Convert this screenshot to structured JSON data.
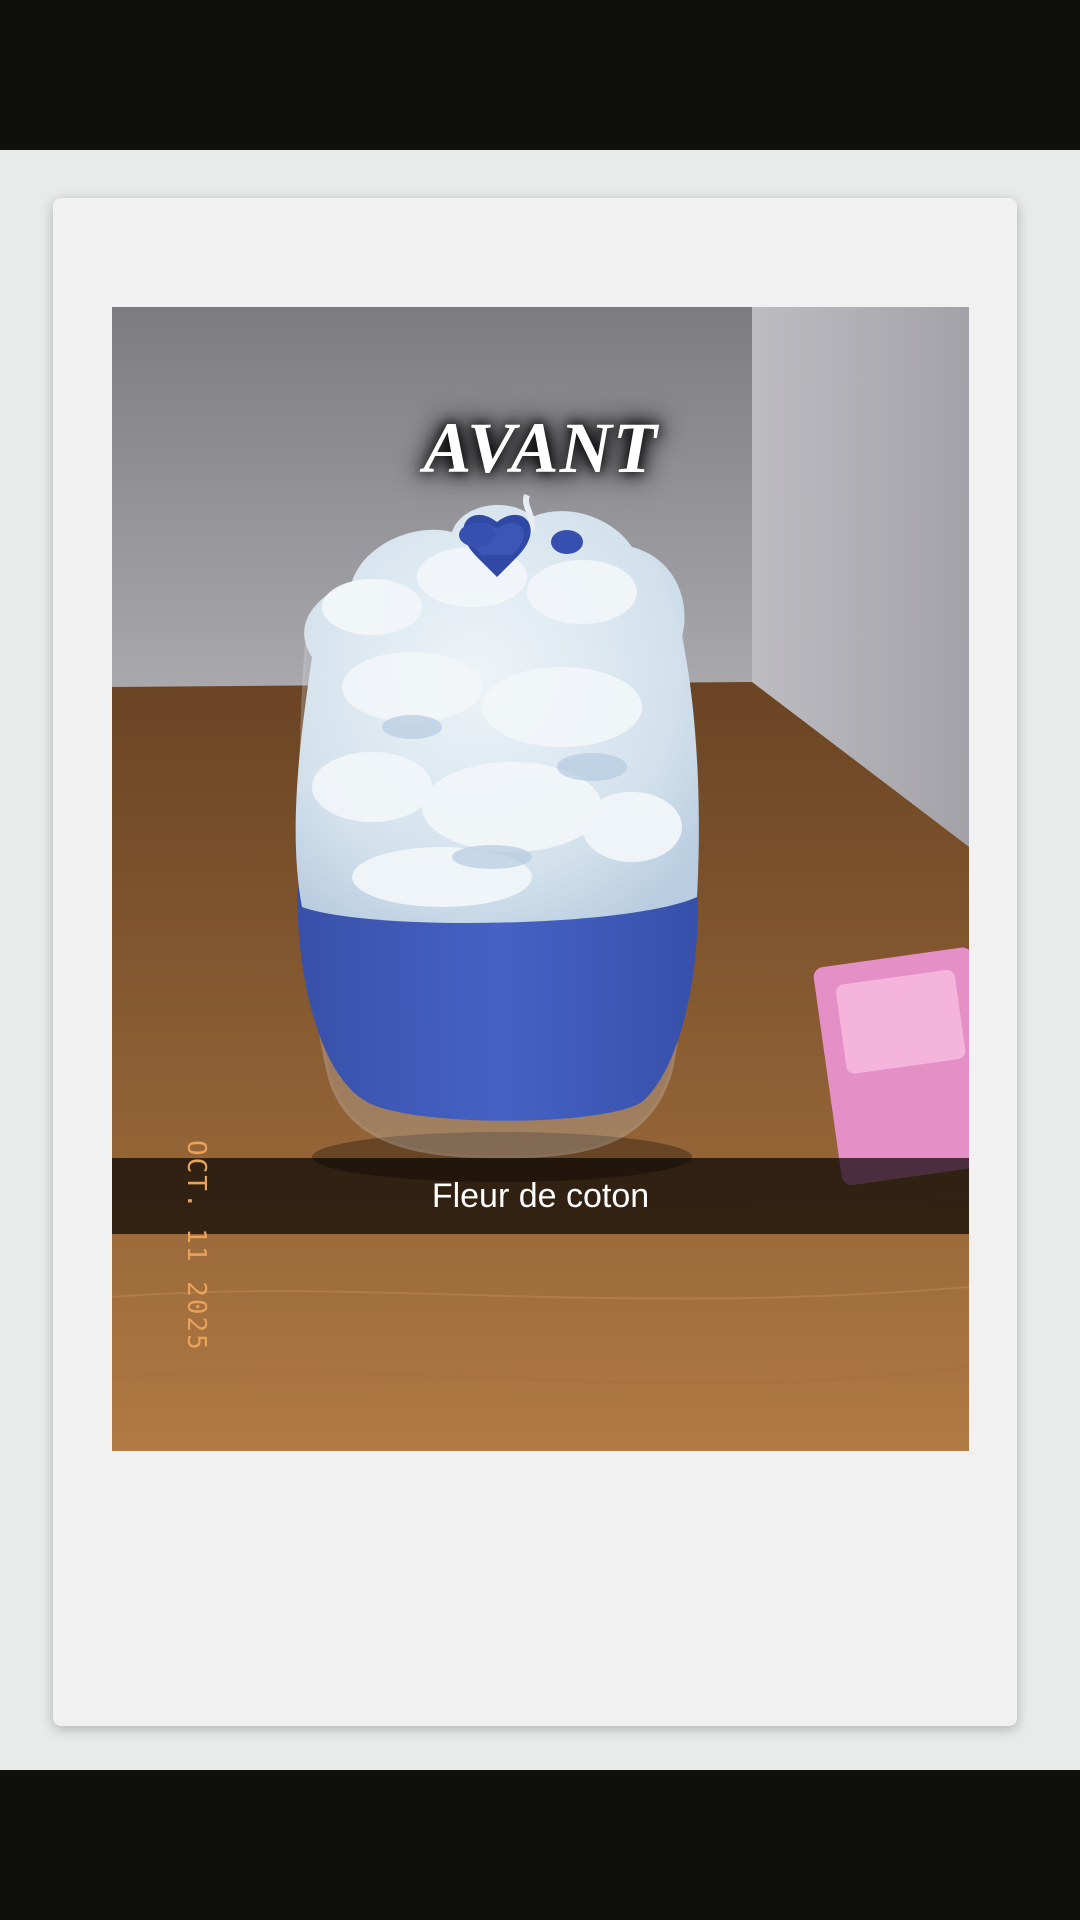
{
  "photo": {
    "headline": "AVANT",
    "caption": "Fleur de coton",
    "datestamp": "OCT. 11 2025"
  },
  "colors": {
    "candle_blue": "#3f59b7",
    "whipped_wax": "#dbe6ef",
    "wood": "#8b5f34",
    "datestamp_orange": "#e8a25a"
  }
}
